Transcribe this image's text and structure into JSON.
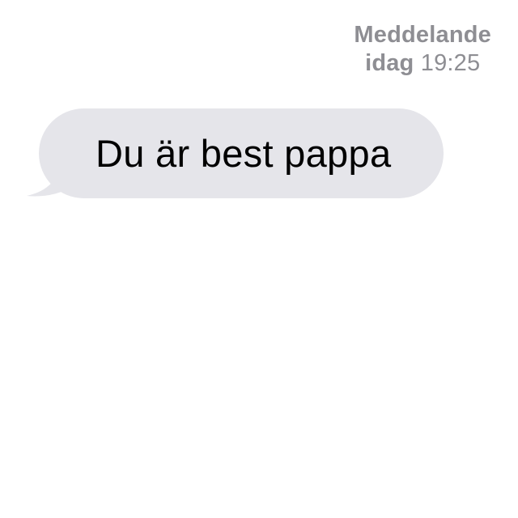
{
  "thread_header": {
    "service": "Meddelande",
    "day": "idag",
    "time": "19:25"
  },
  "messages": [
    {
      "direction": "incoming",
      "text": "Du är best pappa",
      "bubble_color": "#e5e5ea",
      "text_color": "#000000"
    }
  ],
  "colors": {
    "background": "#ffffff",
    "header_text": "#8e8e93",
    "incoming_bubble": "#e5e5ea"
  }
}
